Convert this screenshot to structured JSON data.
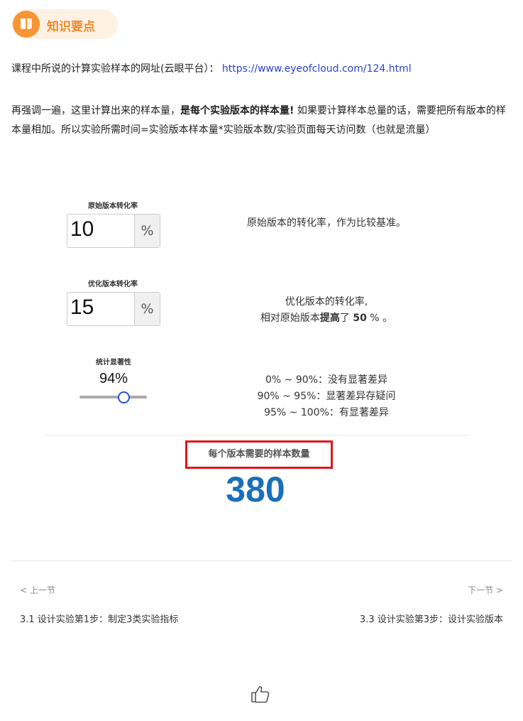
{
  "header": {
    "icon": "book-icon",
    "title": "知识要点"
  },
  "content": {
    "line1_prefix": "课程中所说的计算实验样本的网址(云眼平台）：",
    "line1_link": "https://www.eyeofcloud.com/124.html",
    "p2_part1": "再强调一遍，这里计算出来的样本量，",
    "p2_bold": "是每个实验版本的样本量!",
    "p2_part2": " 如果要计算样本总量的话，需要把所有版本的样本量相加。所以实验所需时间=实验版本样本量*实验版本数/实验页面每天访问数（也就是流量）"
  },
  "calculator": {
    "original_label": "原始版本转化率",
    "original_value": "10",
    "original_unit": "%",
    "original_desc": "原始版本的转化率，作为比较基准。",
    "optimized_label": "优化版本转化率",
    "optimized_value": "15",
    "optimized_unit": "%",
    "optimized_desc_line1": "优化版本的转化率,",
    "optimized_desc_prefix": "相对原始版本",
    "optimized_desc_bold": "提高",
    "optimized_desc_mid": "了 ",
    "optimized_desc_num": "50",
    "optimized_desc_suffix": " % 。",
    "significance_label": "统计显著性",
    "significance_value": "94%",
    "significance_level": 0.94,
    "sig_desc_1": "0% ~ 90%：没有显著差异",
    "sig_desc_2": "90% ~ 95%：显著差异存疑问",
    "sig_desc_3": "95% ~ 100%：有显著差异",
    "result_label": "每个版本需要的样本数量",
    "result_value": "380"
  },
  "nav": {
    "prev_hint": "< 上一节",
    "next_hint": "下一节 >",
    "prev_title": "3.1 设计实验第1步：制定3类实验指标",
    "next_title": "3.3 设计实验第3步：设计实验版本"
  },
  "footer": {
    "like_icon": "thumbs-up-icon"
  },
  "colors": {
    "accent": "#f79433",
    "link": "#2d43c8",
    "result": "#1a6fb8",
    "highlight_border": "#e0161c"
  }
}
